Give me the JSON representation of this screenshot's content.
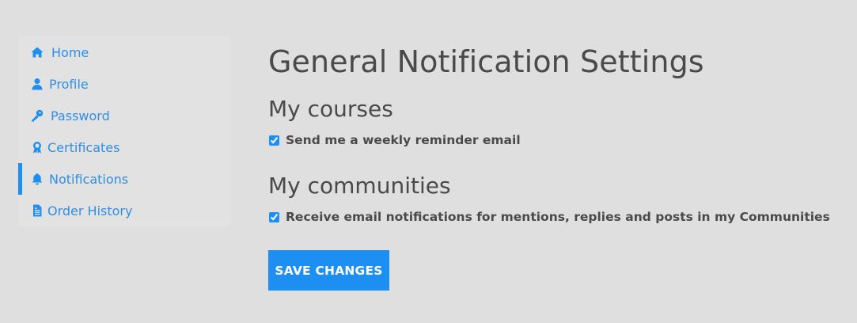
{
  "sidebar": {
    "items": [
      {
        "label": "Home",
        "icon": "home-icon"
      },
      {
        "label": "Profile",
        "icon": "user-icon"
      },
      {
        "label": "Password",
        "icon": "key-icon"
      },
      {
        "label": "Certificates",
        "icon": "award-icon"
      },
      {
        "label": "Notifications",
        "icon": "bell-icon",
        "active": true
      },
      {
        "label": "Order History",
        "icon": "file-text-icon"
      }
    ]
  },
  "main": {
    "title": "General Notification Settings",
    "sections": [
      {
        "title": "My courses",
        "option": {
          "label": "Send me a weekly reminder email",
          "checked": true
        }
      },
      {
        "title": "My communities",
        "option": {
          "label": "Receive email notifications for mentions, replies and posts in my Communities",
          "checked": true
        }
      }
    ],
    "save_label": "SAVE CHANGES"
  },
  "colors": {
    "accent": "#1e8ff2",
    "link": "#2f8ee6",
    "background": "#dfdfdf",
    "text": "#4a4a4a"
  }
}
